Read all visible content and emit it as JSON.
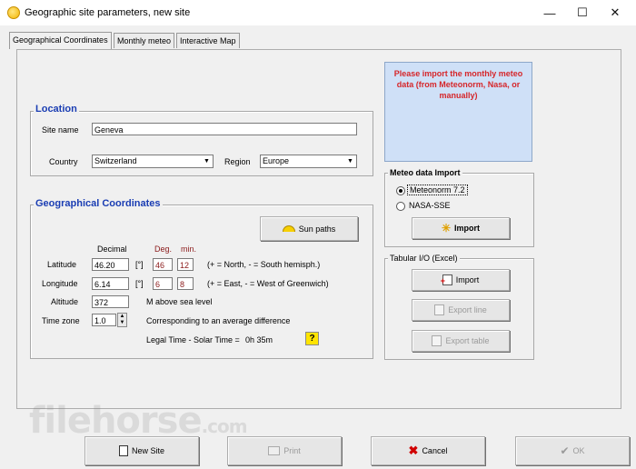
{
  "window": {
    "title": "Geographic site parameters, new site",
    "minimize_glyph": "—",
    "maximize_glyph": "☐",
    "close_glyph": "✕"
  },
  "tabs": [
    {
      "label": "Geographical Coordinates",
      "active": true
    },
    {
      "label": "Monthly meteo",
      "active": false
    },
    {
      "label": "Interactive Map",
      "active": false
    }
  ],
  "location": {
    "group_title": "Location",
    "site_name_label": "Site name",
    "site_name_value": "Geneva",
    "country_label": "Country",
    "country_value": "Switzerland",
    "region_label": "Region",
    "region_value": "Europe"
  },
  "geo": {
    "group_title": "Geographical Coordinates",
    "sun_paths_button": "Sun paths",
    "decimal_header": "Decimal",
    "deg_header": "Deg.",
    "min_header": "min.",
    "latitude_label": "Latitude",
    "latitude_decimal": "46.20",
    "latitude_unit": "[°]",
    "latitude_deg": "46",
    "latitude_min": "12",
    "latitude_hint": "(+ = North,  - = South hemisph.)",
    "longitude_label": "Longitude",
    "longitude_decimal": "6.14",
    "longitude_unit": "[°]",
    "longitude_deg": "6",
    "longitude_min": "8",
    "longitude_hint": "(+ = East, - = West of Greenwich)",
    "altitude_label": "Altitude",
    "altitude_value": "372",
    "altitude_unit": "M above sea level",
    "timezone_label": "Time zone",
    "timezone_value": "1.0",
    "timezone_hint": "Corresponding to an average difference",
    "legal_time_label": "Legal Time - Solar Time =",
    "legal_time_value": "0h 35m",
    "help_glyph": "?"
  },
  "meteo_note": "Please import the monthly meteo data (from Meteonorm, Nasa, or manually)",
  "meteo_import": {
    "group_title": "Meteo data Import",
    "options": [
      "Meteonorm 7.2",
      "NASA-SSE"
    ],
    "selected": "Meteonorm 7.2",
    "import_button": "Import"
  },
  "tabular": {
    "group_title": "Tabular I/O (Excel)",
    "import_button": "Import",
    "export_line_button": "Export line",
    "export_table_button": "Export table"
  },
  "bottom_buttons": {
    "new_site": "New Site",
    "print": "Print",
    "cancel": "Cancel",
    "ok": "OK"
  },
  "watermark": {
    "main": "filehorse",
    "suffix": ".com"
  }
}
